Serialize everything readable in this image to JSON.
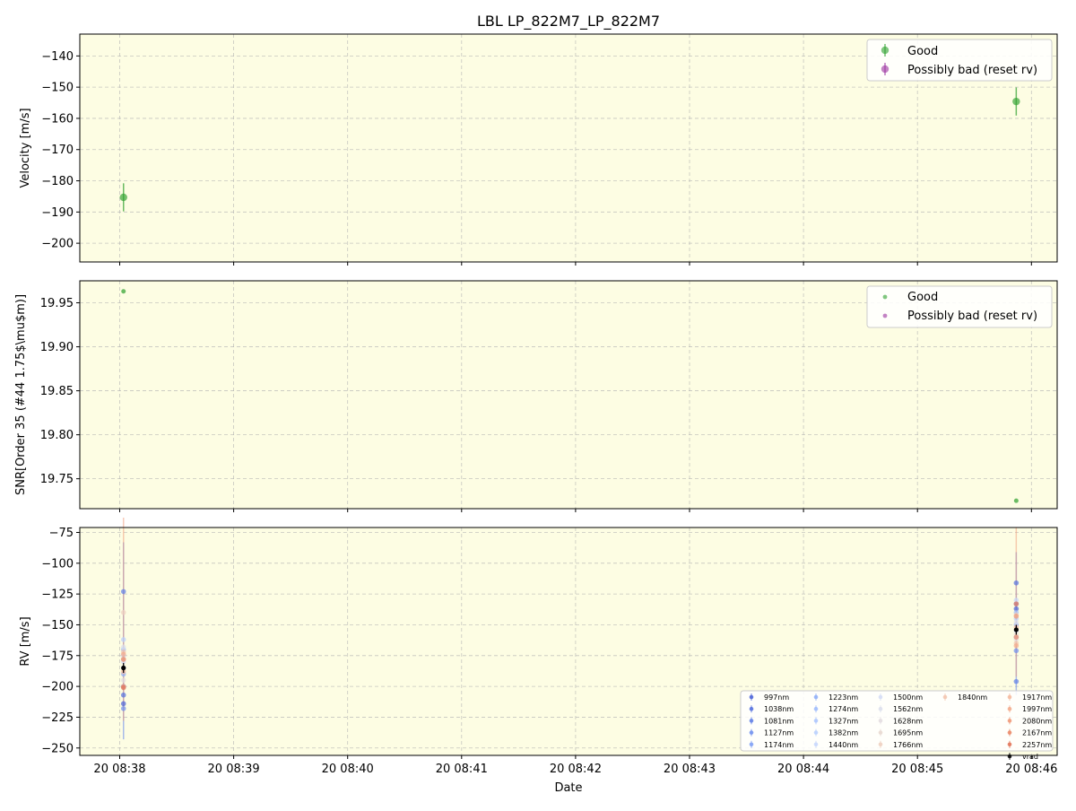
{
  "chart_data": [
    {
      "type": "scatter",
      "title": "LBL LP_822M7_LP_822M7",
      "ylabel": "Velocity [m/s]",
      "xlabel": "",
      "ylim": [
        -206,
        -133
      ],
      "yticks": [
        -140,
        -150,
        -160,
        -170,
        -180,
        -190,
        -200
      ],
      "grid": true,
      "legend": "top-right",
      "series": [
        {
          "name": "Good",
          "color": "#2ca02c",
          "points": [
            {
              "x": "20 08:38:02",
              "y": -185.3,
              "err": 4.5
            },
            {
              "x": "20 08:45:52",
              "y": -154.6,
              "err": 4.5
            }
          ]
        },
        {
          "name": "Possibly bad (reset rv)",
          "color": "#9b30a0",
          "points": []
        }
      ]
    },
    {
      "type": "scatter",
      "ylabel": "SNR[Order 35 (#44 1.75$\\mu$m)]",
      "ylim": [
        19.716,
        19.975
      ],
      "yticks": [
        "19.95",
        "19.90",
        "19.85",
        "19.80",
        "19.75"
      ],
      "ytick_values": [
        19.95,
        19.9,
        19.85,
        19.8,
        19.75
      ],
      "grid": true,
      "legend": "top-right",
      "series": [
        {
          "name": "Good",
          "color": "#2ca02c",
          "points": [
            {
              "x": "20 08:38:02",
              "y": 19.963
            },
            {
              "x": "20 08:45:52",
              "y": 19.725
            }
          ]
        },
        {
          "name": "Possibly bad (reset rv)",
          "color": "#9b30a0",
          "points": []
        }
      ]
    },
    {
      "type": "scatter",
      "ylabel": "RV [m/s]",
      "xlabel": "Date",
      "ylim": [
        -256,
        -71
      ],
      "yticks": [
        -75,
        -100,
        -125,
        -150,
        -175,
        -200,
        -225,
        -250
      ],
      "xticks": [
        "20 08:38",
        "20 08:39",
        "20 08:40",
        "20 08:41",
        "20 08:42",
        "20 08:43",
        "20 08:44",
        "20 08:45",
        "20 08:46"
      ],
      "grid": true,
      "legend": "lower-right",
      "series": [
        {
          "name": "997nm",
          "color": "#4a62d8",
          "values": [
            -214,
            -137
          ]
        },
        {
          "name": "1038nm",
          "color": "#5470de",
          "values": [
            -207,
            -116
          ]
        },
        {
          "name": "1081nm",
          "color": "#607fe6",
          "values": [
            -123,
            -196
          ]
        },
        {
          "name": "1127nm",
          "color": "#6f8fee",
          "values": [
            -218,
            -171
          ]
        },
        {
          "name": "1174nm",
          "color": "#7fa0f4",
          "values": [
            -200,
            -133
          ]
        },
        {
          "name": "1223nm",
          "color": "#8eaef8",
          "values": [
            -190,
            -150
          ]
        },
        {
          "name": "1274nm",
          "color": "#9dbbfb",
          "values": [
            -170,
            -140
          ]
        },
        {
          "name": "1327nm",
          "color": "#abc5fd",
          "values": [
            -185,
            -160
          ]
        },
        {
          "name": "1382nm",
          "color": "#b9d0fd",
          "values": [
            -162,
            -145
          ]
        },
        {
          "name": "1440nm",
          "color": "#c7d7fb",
          "values": [
            -175,
            -130
          ]
        },
        {
          "name": "1500nm",
          "color": "#d3dcf5",
          "values": [
            -180,
            -155
          ]
        },
        {
          "name": "1562nm",
          "color": "#dcdfec",
          "values": [
            -168,
            -148
          ]
        },
        {
          "name": "1628nm",
          "color": "#e3dde0",
          "values": [
            -195,
            -162
          ]
        },
        {
          "name": "1695nm",
          "color": "#e8d8d0",
          "values": [
            -178,
            -158
          ]
        },
        {
          "name": "1766nm",
          "color": "#eed0c0",
          "values": [
            -140,
            -142
          ]
        },
        {
          "name": "1840nm",
          "color": "#f2c5ae",
          "values": [
            -172,
            -165
          ]
        },
        {
          "name": "1917nm",
          "color": "#f4b89c",
          "values": [
            -188,
            -152
          ]
        },
        {
          "name": "1997nm",
          "color": "#f3a98a",
          "values": [
            -174,
            -167
          ]
        },
        {
          "name": "2080nm",
          "color": "#f09877",
          "values": [
            -200,
            -143
          ]
        },
        {
          "name": "2167nm",
          "color": "#ea8665",
          "values": [
            -178,
            -160
          ]
        },
        {
          "name": "2257nm",
          "color": "#e27255",
          "values": [
            -201,
            -133
          ]
        },
        {
          "name": "vrad",
          "color": "#000000",
          "values": [
            -185,
            -154
          ]
        }
      ],
      "x": [
        "20 08:38:02",
        "20 08:45:52"
      ]
    }
  ]
}
